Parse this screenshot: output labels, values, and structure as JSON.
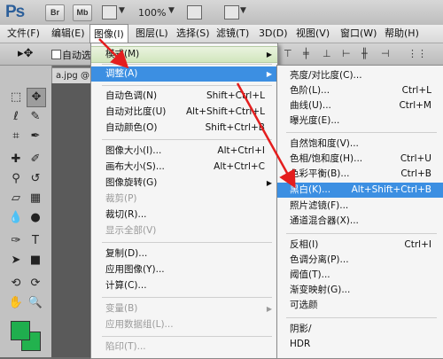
{
  "app": {
    "logo": "Ps",
    "bridge_label": "Br",
    "minibridge_label": "Mb",
    "zoom": "100%"
  },
  "menubar": {
    "items": [
      {
        "label": "文件(F)"
      },
      {
        "label": "编辑(E)"
      },
      {
        "label": "图像(I)"
      },
      {
        "label": "图层(L)"
      },
      {
        "label": "选择(S)"
      },
      {
        "label": "滤镜(T)"
      },
      {
        "label": "3D(D)"
      },
      {
        "label": "视图(V)"
      },
      {
        "label": "窗口(W)"
      },
      {
        "label": "帮助(H)"
      }
    ]
  },
  "options": {
    "auto_select_label": "自动选"
  },
  "document": {
    "tab_label": "a.jpg @"
  },
  "image_menu": {
    "mode": "模式(M)",
    "adjust": "调整(A)",
    "auto_tone": "自动色调(N)",
    "auto_tone_sc": "Shift+Ctrl+L",
    "auto_contrast": "自动对比度(U)",
    "auto_contrast_sc": "Alt+Shift+Ctrl+L",
    "auto_color": "自动颜色(O)",
    "auto_color_sc": "Shift+Ctrl+B",
    "image_size": "图像大小(I)...",
    "image_size_sc": "Alt+Ctrl+I",
    "canvas_size": "画布大小(S)...",
    "canvas_size_sc": "Alt+Ctrl+C",
    "rotation": "图像旋转(G)",
    "crop": "裁剪(P)",
    "trim": "裁切(R)...",
    "reveal_all": "显示全部(V)",
    "duplicate": "复制(D)...",
    "apply_image": "应用图像(Y)...",
    "calculations": "计算(C)...",
    "variables": "变量(B)",
    "apply_dataset": "应用数据组(L)...",
    "trap": "陷印(T)..."
  },
  "adjust_menu": {
    "brightness": "亮度/对比度(C)...",
    "levels": "色阶(L)...",
    "levels_sc": "Ctrl+L",
    "curves": "曲线(U)...",
    "curves_sc": "Ctrl+M",
    "exposure": "曝光度(E)...",
    "vibrance": "自然饱和度(V)...",
    "hue_sat": "色相/饱和度(H)...",
    "hue_sat_sc": "Ctrl+U",
    "color_balance": "色彩平衡(B)...",
    "color_balance_sc": "Ctrl+B",
    "black_white": "黑白(K)...",
    "black_white_sc": "Alt+Shift+Ctrl+B",
    "photo_filter": "照片滤镜(F)...",
    "channel_mixer": "通道混合器(X)...",
    "invert": "反相(I)",
    "invert_sc": "Ctrl+I",
    "posterize": "色调分离(P)...",
    "threshold": "阈值(T)...",
    "gradient_map": "渐变映射(G)...",
    "selective_color": "可选颜",
    "shadows_highlights": "阴影/",
    "hdr": "HDR"
  },
  "colors": {
    "highlight": "#3c8fe2",
    "foreground_swatch": "#1fae4e",
    "background_swatch": "#22b24e",
    "annotation_arrow": "#e41e1e"
  }
}
